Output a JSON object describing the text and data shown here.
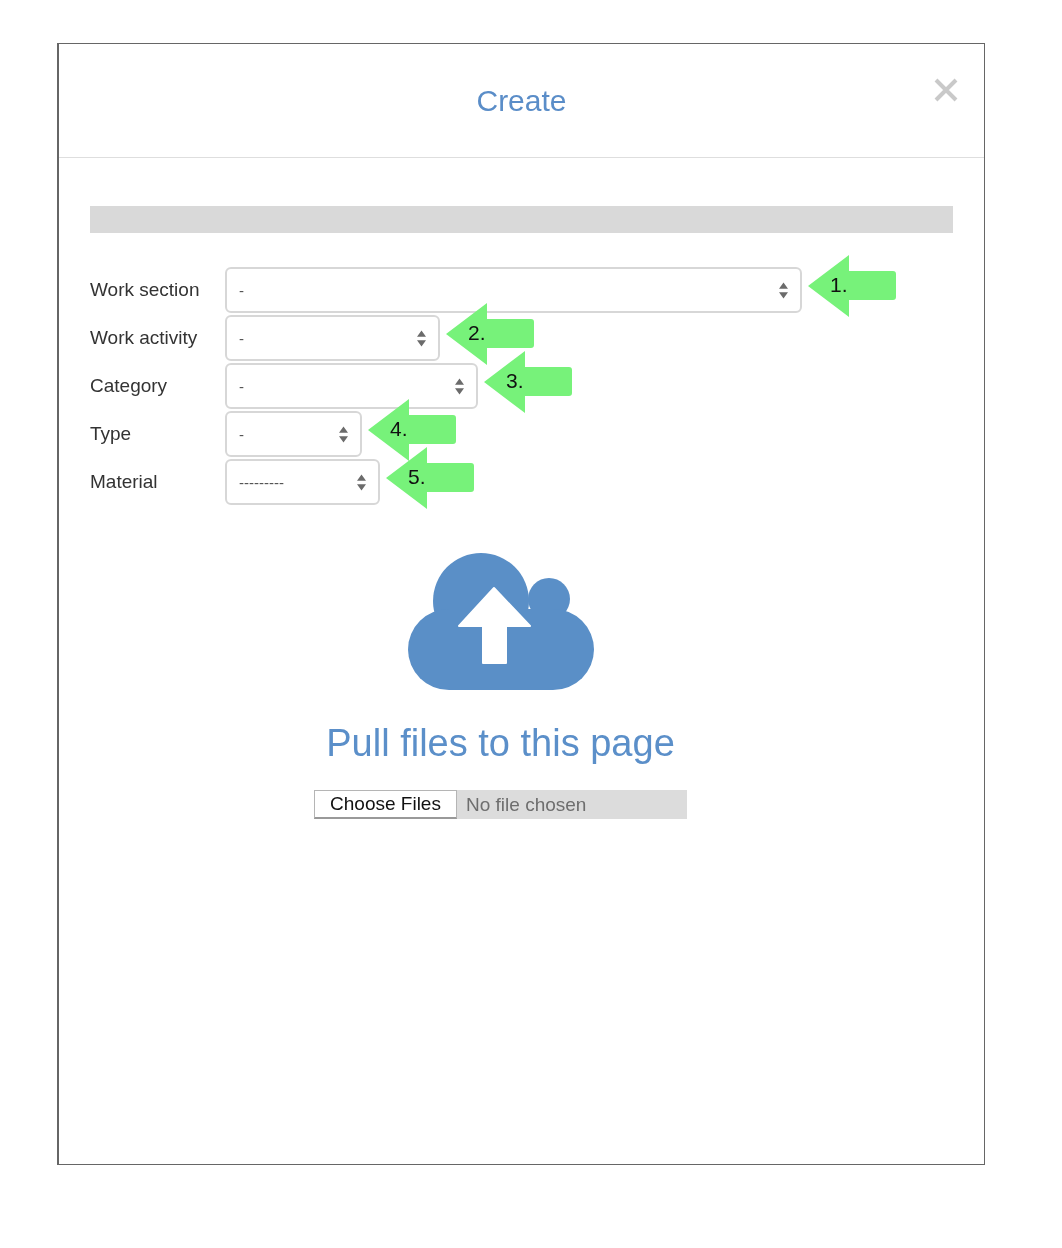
{
  "dialog": {
    "title": "Create"
  },
  "form": {
    "fields": [
      {
        "label": "Work section",
        "value": "-",
        "callout": "1."
      },
      {
        "label": "Work activity",
        "value": "-",
        "callout": "2."
      },
      {
        "label": "Category",
        "value": "-",
        "callout": "3."
      },
      {
        "label": "Type",
        "value": "-",
        "callout": "4."
      },
      {
        "label": "Material",
        "value": "---------",
        "callout": "5."
      }
    ]
  },
  "upload": {
    "prompt": "Pull files to this page",
    "button": "Choose Files",
    "status": "No file chosen"
  }
}
